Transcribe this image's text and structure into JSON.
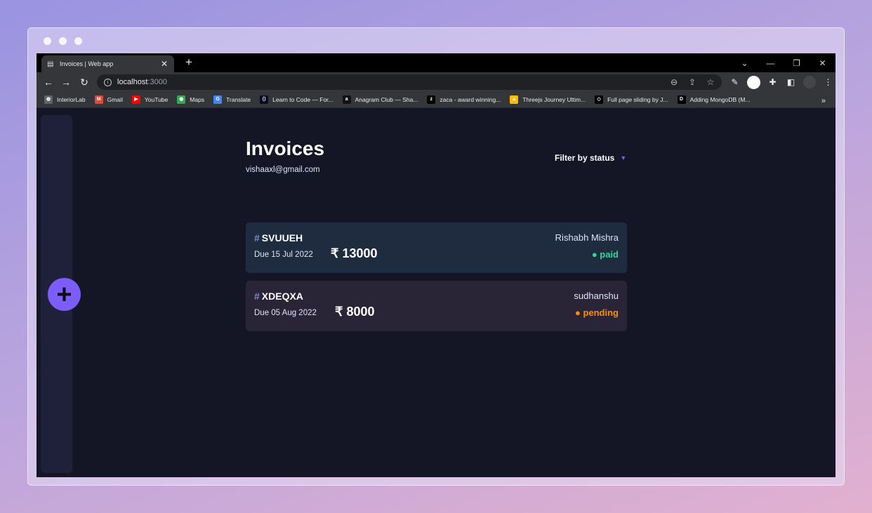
{
  "browser": {
    "tab_title": "Invoices | Web app",
    "url_host": "localhost",
    "url_port": ":3000",
    "bookmarks": [
      {
        "label": "InteriorLab",
        "icon": "globe-icon",
        "color": "#5f6368"
      },
      {
        "label": "Gmail",
        "icon": "gmail-icon",
        "color": "#ea4335"
      },
      {
        "label": "YouTube",
        "icon": "youtube-icon",
        "color": "#ff0000"
      },
      {
        "label": "Maps",
        "icon": "maps-icon",
        "color": "#34a853"
      },
      {
        "label": "Translate",
        "icon": "translate-icon",
        "color": "#4285f4"
      },
      {
        "label": "Learn to Code — For...",
        "icon": "freecodecamp-icon",
        "color": "#0a0a23"
      },
      {
        "label": "Anagram Club — Sha...",
        "icon": "anagram-icon",
        "color": "#111111"
      },
      {
        "label": "zaca - award winning...",
        "icon": "zaca-icon",
        "color": "#000000"
      },
      {
        "label": "Threejs Journey Ultim...",
        "icon": "drive-icon",
        "color": "#fbbc04"
      },
      {
        "label": "Full page sliding by J...",
        "icon": "codepen-icon",
        "color": "#000000"
      },
      {
        "label": "Adding MongoDB (M...",
        "icon": "dev-icon",
        "color": "#000000"
      }
    ],
    "bookmark_more": "»"
  },
  "app": {
    "title": "Invoices",
    "email": "vishaaxl@gmail.com",
    "filter_label": "Filter by status",
    "add_symbol": "+",
    "accent": "#7c5dfa",
    "invoices": [
      {
        "hash": "#",
        "id": "SVUUEH",
        "due": "Due 15 Jul 2022",
        "amount": "₹ 13000",
        "client": "Rishabh Mishra",
        "status": "● paid",
        "status_color": "#33d69f"
      },
      {
        "hash": "#",
        "id": "XDEQXA",
        "due": "Due 05 Aug 2022",
        "amount": "₹ 8000",
        "client": "sudhanshu",
        "status": "● pending",
        "status_color": "#ff8f00"
      }
    ]
  }
}
